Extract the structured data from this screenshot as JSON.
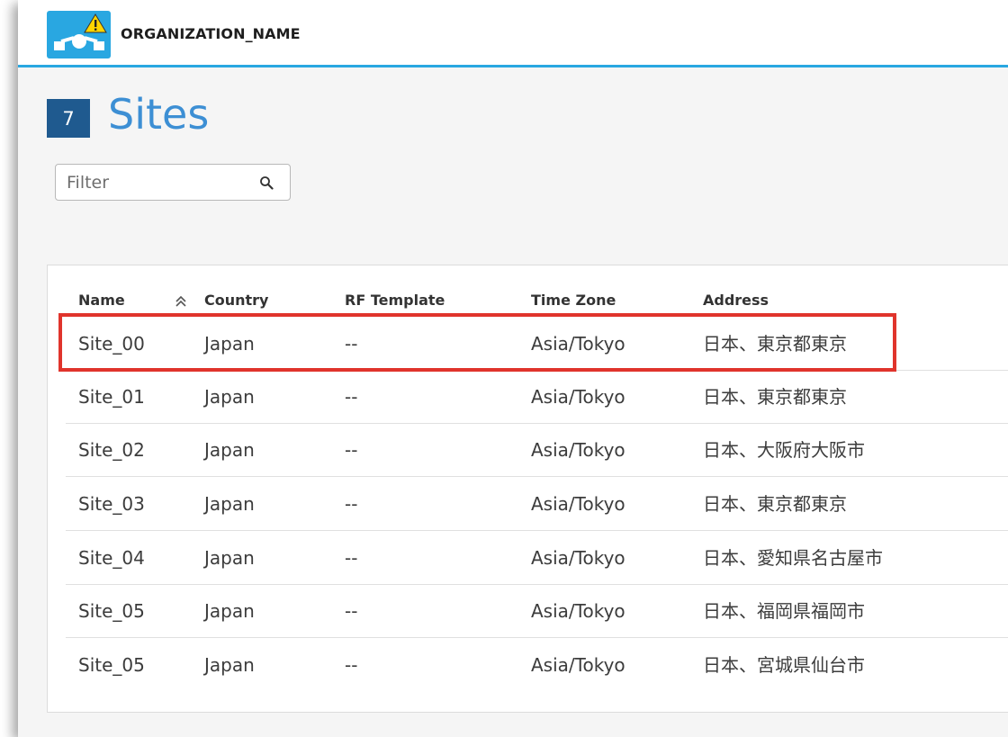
{
  "header": {
    "org_name": "ORGANIZATION_NAME",
    "logo_icon": "network-warning-logo-icon",
    "accent_color": "#29a7e1"
  },
  "page": {
    "count": "7",
    "title": "Sites"
  },
  "filter": {
    "placeholder": "Filter",
    "value": "",
    "icon": "search-icon"
  },
  "table": {
    "columns": [
      "Name",
      "Country",
      "RF Template",
      "Time Zone",
      "Address"
    ],
    "sorted_column": "Name",
    "rows": [
      {
        "name": "Site_00",
        "country": "Japan",
        "rf_template": "--",
        "time_zone": "Asia/Tokyo",
        "address": "日本、東京都東京"
      },
      {
        "name": "Site_01",
        "country": "Japan",
        "rf_template": "--",
        "time_zone": "Asia/Tokyo",
        "address": "日本、東京都東京"
      },
      {
        "name": "Site_02",
        "country": "Japan",
        "rf_template": "--",
        "time_zone": "Asia/Tokyo",
        "address": "日本、大阪府大阪市"
      },
      {
        "name": "Site_03",
        "country": "Japan",
        "rf_template": "--",
        "time_zone": "Asia/Tokyo",
        "address": "日本、東京都東京"
      },
      {
        "name": "Site_04",
        "country": "Japan",
        "rf_template": "--",
        "time_zone": "Asia/Tokyo",
        "address": "日本、愛知県名古屋市"
      },
      {
        "name": "Site_05",
        "country": "Japan",
        "rf_template": "--",
        "time_zone": "Asia/Tokyo",
        "address": "日本、福岡県福岡市"
      },
      {
        "name": "Site_05",
        "country": "Japan",
        "rf_template": "--",
        "time_zone": "Asia/Tokyo",
        "address": "日本、宮城県仙台市"
      }
    ]
  },
  "annotation": {
    "highlight_color": "#e0342c"
  }
}
